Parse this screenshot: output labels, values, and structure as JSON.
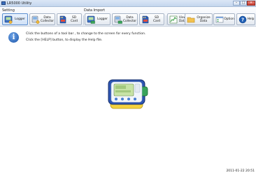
{
  "window": {
    "title": "LR5000 Utility",
    "controls": {
      "minimize": "–",
      "maximize": "□",
      "close": "×"
    }
  },
  "toolbar": {
    "setting_group": {
      "label": "Setting",
      "buttons": [
        {
          "label": "Logger",
          "icon": "logger-setting-icon"
        },
        {
          "label": "Data Collector",
          "icon": "data-collector-setting-icon"
        },
        {
          "label": "SD Card",
          "icon": "sd-card-icon"
        }
      ]
    },
    "import_group": {
      "label": "Data Import",
      "buttons": [
        {
          "label": "Logger",
          "icon": "logger-import-icon"
        },
        {
          "label": "Data Collector",
          "icon": "data-collector-import-icon"
        },
        {
          "label": "SD Card",
          "icon": "sd-card-import-icon"
        }
      ]
    },
    "other_buttons": [
      {
        "label": "View Data",
        "icon": "view-data-icon"
      },
      {
        "label": "Organize Data",
        "icon": "folder-icon"
      },
      {
        "label": "Option",
        "icon": "option-icon"
      },
      {
        "label": "Help",
        "icon": "help-icon"
      }
    ]
  },
  "info": {
    "line1": "Click the buttons of a tool bar , to change to the screen for every function.",
    "line2": "Click the [HELP] button, to display the Help file."
  },
  "status": {
    "timestamp": "2011-01-22 20:51"
  },
  "colors": {
    "accent": "#2a6bc2",
    "titlebar": "#c4d6ee",
    "device_body": "#2d55b3"
  }
}
